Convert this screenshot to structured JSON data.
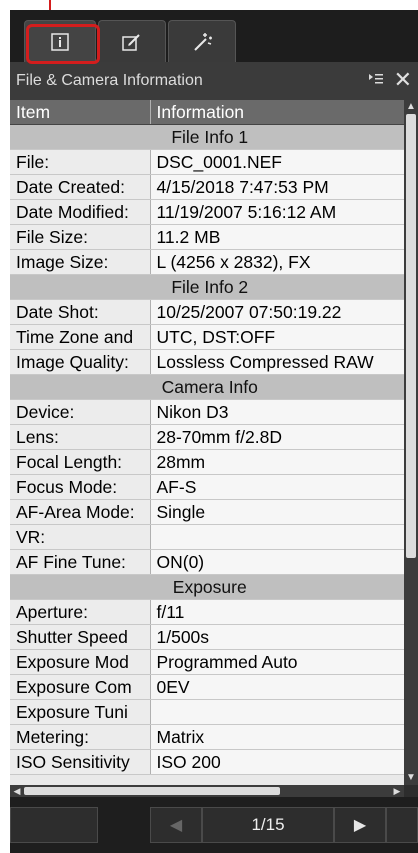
{
  "tabs": [
    {
      "icon": "info-icon",
      "active": true
    },
    {
      "icon": "edit-icon",
      "active": false
    },
    {
      "icon": "magic-wand-icon",
      "active": false
    }
  ],
  "panel": {
    "title": "File & Camera Information",
    "options_icon": "panel-options-icon",
    "close_label": "✕"
  },
  "table": {
    "headers": [
      "Item",
      "Information"
    ],
    "sections": [
      {
        "name": "File Info 1",
        "rows": [
          {
            "item": "File:",
            "info": "DSC_0001.NEF"
          },
          {
            "item": "Date Created:",
            "info": "4/15/2018 7:47:53 PM"
          },
          {
            "item": "Date Modified:",
            "info": "11/19/2007 5:16:12 AM"
          },
          {
            "item": "File Size:",
            "info": "11.2 MB"
          },
          {
            "item": "Image Size:",
            "info": "L (4256 x 2832), FX"
          }
        ]
      },
      {
        "name": "File Info 2",
        "rows": [
          {
            "item": "Date Shot:",
            "info": "10/25/2007 07:50:19.22"
          },
          {
            "item": "Time Zone and",
            "info": "UTC, DST:OFF"
          },
          {
            "item": "Image Quality:",
            "info": "Lossless Compressed RAW"
          }
        ]
      },
      {
        "name": "Camera Info",
        "rows": [
          {
            "item": "Device:",
            "info": "Nikon D3"
          },
          {
            "item": "Lens:",
            "info": "28-70mm f/2.8D"
          },
          {
            "item": "Focal Length:",
            "info": "28mm"
          },
          {
            "item": "Focus Mode:",
            "info": "AF-S"
          },
          {
            "item": "AF-Area Mode:",
            "info": "Single"
          },
          {
            "item": "VR:",
            "info": ""
          },
          {
            "item": "AF Fine Tune:",
            "info": "ON(0)"
          }
        ]
      },
      {
        "name": "Exposure",
        "rows": [
          {
            "item": "Aperture:",
            "info": "f/11"
          },
          {
            "item": "Shutter Speed",
            "info": "1/500s"
          },
          {
            "item": "Exposure Mod",
            "info": "Programmed Auto"
          },
          {
            "item": "Exposure Com",
            "info": "0EV"
          },
          {
            "item": "Exposure Tuni",
            "info": ""
          },
          {
            "item": "Metering:",
            "info": "Matrix"
          },
          {
            "item": "ISO Sensitivity",
            "info": "ISO 200"
          }
        ]
      }
    ]
  },
  "navigation": {
    "page_label": "1/15",
    "prev_label": "◀",
    "next_label": "▶"
  },
  "colors": {
    "highlight": "#d31d1d",
    "panel_bg": "#2a2a2a",
    "section_bg": "#bfbfbf",
    "header_bg": "#6a6a6a"
  }
}
